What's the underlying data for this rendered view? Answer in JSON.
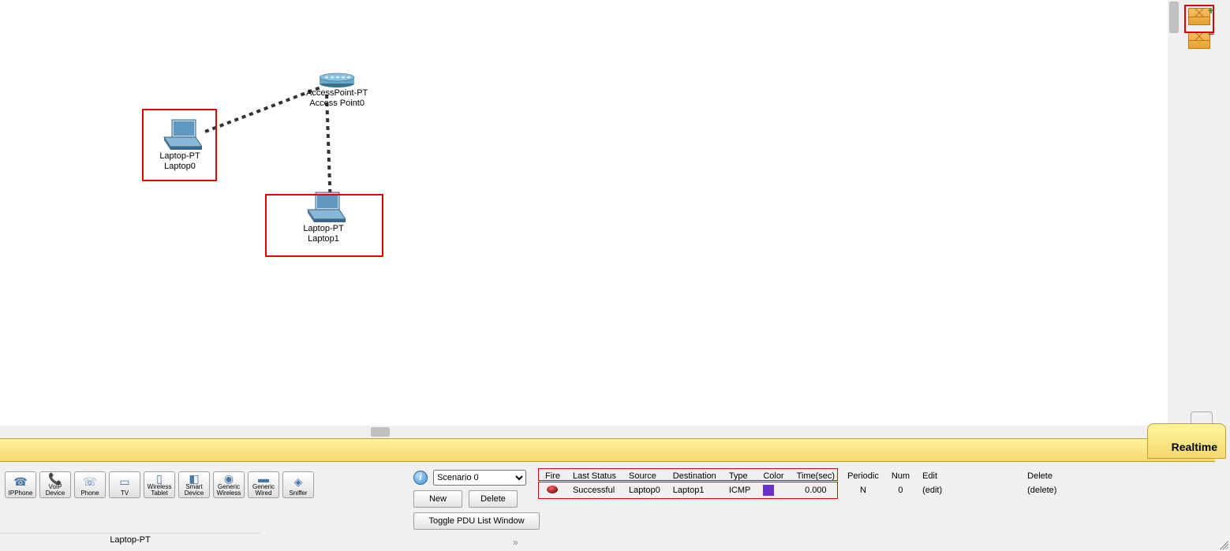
{
  "realtime_label": "Realtime",
  "devices": {
    "accesspoint": {
      "type_label": "AccessPoint-PT",
      "name": "Access Point0"
    },
    "laptop0": {
      "type_label": "Laptop-PT",
      "name": "Laptop0"
    },
    "laptop1": {
      "type_label": "Laptop-PT",
      "name": "Laptop1"
    }
  },
  "device_buttons": [
    {
      "id": "ipphone",
      "label": "IPPhone"
    },
    {
      "id": "voip",
      "label": "VoIP Device"
    },
    {
      "id": "phone",
      "label": "Phone"
    },
    {
      "id": "tv",
      "label": "TV"
    },
    {
      "id": "wtablet",
      "label": "Wireless Tablet"
    },
    {
      "id": "smart",
      "label": "Smart Device"
    },
    {
      "id": "gwireless",
      "label": "Generic Wireless"
    },
    {
      "id": "gwired",
      "label": "Generic Wired"
    },
    {
      "id": "sniffer",
      "label": "Sniffer"
    }
  ],
  "status_device": "Laptop-PT",
  "scenario": {
    "selected": "Scenario 0",
    "btn_new": "New",
    "btn_delete": "Delete",
    "btn_toggle": "Toggle PDU List Window"
  },
  "pdu_table": {
    "headers": {
      "fire": "Fire",
      "last_status": "Last Status",
      "source": "Source",
      "destination": "Destination",
      "type": "Type",
      "color": "Color",
      "time": "Time(sec)",
      "periodic": "Periodic",
      "num": "Num",
      "edit": "Edit",
      "delete": "Delete"
    },
    "rows": [
      {
        "last_status": "Successful",
        "source": "Laptop0",
        "destination": "Laptop1",
        "type": "ICMP",
        "color": "#6a30c8",
        "time": "0.000",
        "periodic": "N",
        "num": "0",
        "edit": "(edit)",
        "delete": "(delete)"
      }
    ]
  }
}
